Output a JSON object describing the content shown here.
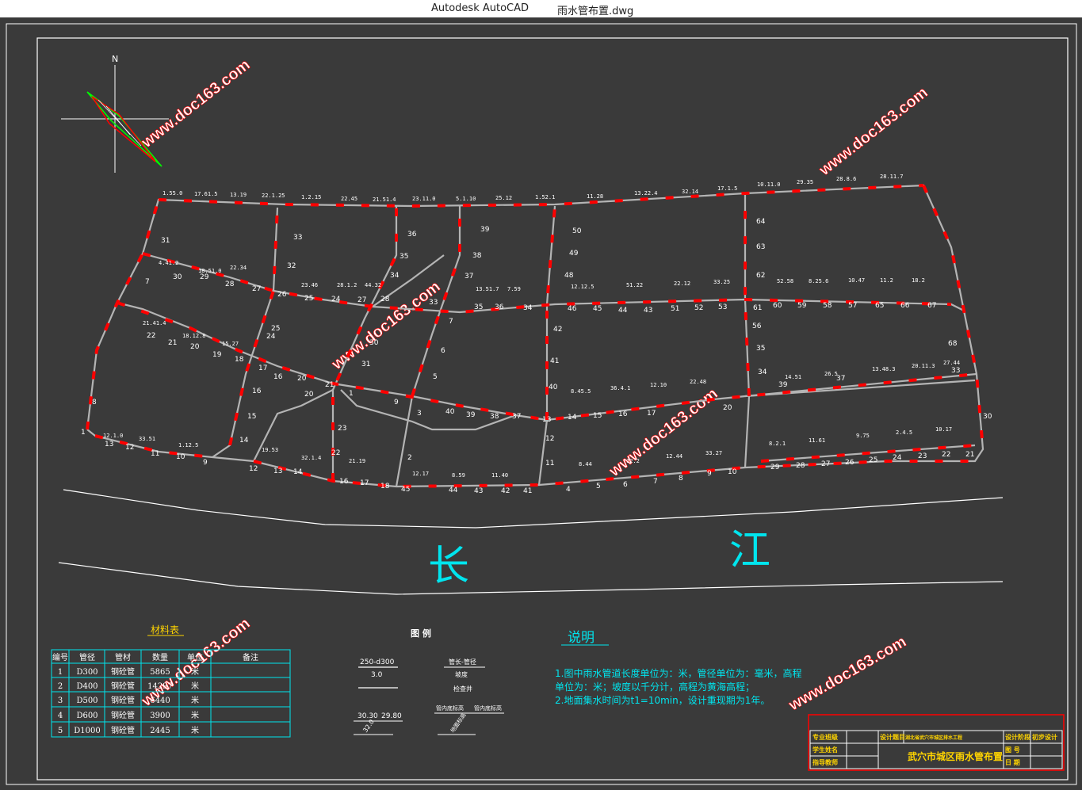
{
  "window": {
    "app_name": "Autodesk AutoCAD",
    "file_name": "雨水管布置.dwg"
  },
  "compass": {
    "north_label": "N"
  },
  "watermark": "www.doc163.com",
  "river": {
    "char1": "长",
    "char2": "江"
  },
  "material_table": {
    "title": "材料表",
    "headers": [
      "编号",
      "管径",
      "管材",
      "数量",
      "单位",
      "备注"
    ],
    "rows": [
      [
        "1",
        "D300",
        "钢砼管",
        "5865",
        "米",
        ""
      ],
      [
        "2",
        "D400",
        "钢砼管",
        "14297",
        "米",
        ""
      ],
      [
        "3",
        "D500",
        "钢砼管",
        "6440",
        "米",
        ""
      ],
      [
        "4",
        "D600",
        "钢砼管",
        "3900",
        "米",
        ""
      ],
      [
        "5",
        "D1000",
        "钢砼管",
        "2445",
        "米",
        ""
      ]
    ]
  },
  "legend": {
    "title": "图  例",
    "pipe_top": "250-d300",
    "pipe_bottom": "3.0",
    "pipe_desc_top": "管长-管径",
    "pipe_desc_bottom": "坡度",
    "well_desc": "检查井",
    "elev_left": "30.30",
    "elev_right": "29.80",
    "elev_lower": "32.0",
    "elev_desc_left": "管内底标高",
    "elev_desc_right": "管内底标高",
    "elev_desc_lower": "地面标高"
  },
  "notes": {
    "title": "说明",
    "line1": "1.图中雨水管道长度单位为：米，管径单位为：毫米，高程",
    "line2": "单位为：米；坡度以千分计，高程为黄海高程；",
    "line3": "2.地面集水时间为t1=10min，设计重现期为1年。"
  },
  "title_block": {
    "major_label": "专业班级",
    "student_label": "学生姓名",
    "advisor_label": "指导教师",
    "design_topic_label": "设计题目",
    "design_topic": "湖北省武穴市城区排水工程",
    "drawing_title": "武穴市城区雨水管布置",
    "stage_label": "设计阶段",
    "stage_value": "初步设计",
    "sheet_label": "图  号",
    "date_label": "日  期"
  },
  "network": {
    "pipe_color": "#b4b4b4",
    "label_color": "#ffffff",
    "slope_mark_color": "#ff0000",
    "frame_color": "#ffffff",
    "cyan": "#00e5ee",
    "labels_north": [
      "31",
      "30",
      "33",
      "32",
      "36",
      "35",
      "34",
      "39",
      "38",
      "50",
      "49",
      "48",
      "64",
      "63",
      "62"
    ],
    "labels_mid": [
      "30",
      "29",
      "28",
      "27",
      "26",
      "25",
      "24",
      "23",
      "22",
      "21",
      "20",
      "19",
      "18",
      "17",
      "16",
      "37",
      "36",
      "34",
      "45",
      "44",
      "43",
      "52",
      "53",
      "60",
      "59",
      "58",
      "57",
      "65",
      "66",
      "67",
      "68"
    ],
    "labels_south": [
      "13",
      "12",
      "11",
      "10",
      "9",
      "12",
      "13",
      "14",
      "16",
      "17",
      "18",
      "45",
      "44",
      "43",
      "42",
      "41",
      "4",
      "5",
      "6",
      "7",
      "8",
      "9",
      "10",
      "29",
      "28",
      "27",
      "26",
      "25",
      "24",
      "23",
      "22",
      "21"
    ]
  }
}
